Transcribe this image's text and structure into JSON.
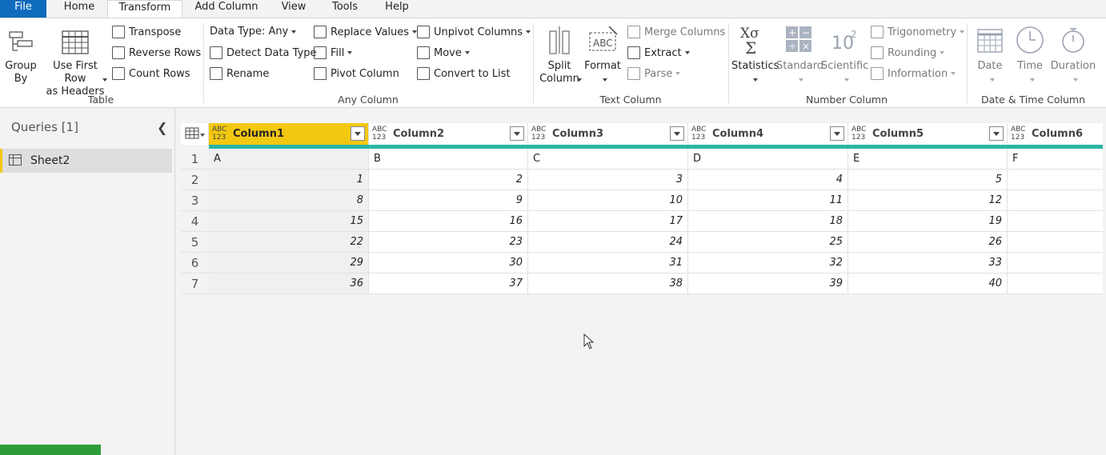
{
  "menu": {
    "tabs": [
      {
        "label": "File"
      },
      {
        "label": "Home"
      },
      {
        "label": "Transform"
      },
      {
        "label": "Add Column"
      },
      {
        "label": "View"
      },
      {
        "label": "Tools"
      },
      {
        "label": "Help"
      }
    ]
  },
  "ribbon": {
    "table": {
      "label": "Table",
      "group_by": "Group\nBy",
      "use_first_row": "Use First Row\nas Headers",
      "transpose": "Transpose",
      "reverse_rows": "Reverse Rows",
      "count_rows": "Count Rows"
    },
    "any_column": {
      "label": "Any Column",
      "data_type": "Data Type: Any",
      "detect_data_type": "Detect Data Type",
      "rename": "Rename",
      "replace_values": "Replace Values",
      "fill": "Fill",
      "pivot_column": "Pivot Column",
      "unpivot_columns": "Unpivot Columns",
      "move": "Move",
      "convert_to_list": "Convert to List"
    },
    "text_column": {
      "label": "Text Column",
      "split_column": "Split\nColumn",
      "format": "Format",
      "merge_columns": "Merge Columns",
      "extract": "Extract",
      "parse": "Parse"
    },
    "number_column": {
      "label": "Number Column",
      "statistics": "Statistics",
      "standard": "Standard",
      "scientific": "Scientific",
      "trigonometry": "Trigonometry",
      "rounding": "Rounding",
      "information": "Information"
    },
    "datetime_column": {
      "label": "Date & Time Column",
      "date": "Date",
      "time": "Time",
      "duration": "Duration"
    }
  },
  "queries": {
    "title": "Queries [1]",
    "items": [
      {
        "label": "Sheet2"
      }
    ]
  },
  "grid": {
    "columns": [
      {
        "type": "ABC\n123",
        "name": "Column1"
      },
      {
        "type": "ABC\n123",
        "name": "Column2"
      },
      {
        "type": "ABC\n123",
        "name": "Column3"
      },
      {
        "type": "ABC\n123",
        "name": "Column4"
      },
      {
        "type": "ABC\n123",
        "name": "Column5"
      },
      {
        "type": "ABC\n123",
        "name": "Column6"
      }
    ],
    "row_numbers": [
      "1",
      "2",
      "3",
      "4",
      "5",
      "6",
      "7"
    ],
    "rows": [
      [
        "A",
        "B",
        "C",
        "D",
        "E",
        "F"
      ],
      [
        "1",
        "2",
        "3",
        "4",
        "5",
        ""
      ],
      [
        "8",
        "9",
        "10",
        "11",
        "12",
        ""
      ],
      [
        "15",
        "16",
        "17",
        "18",
        "19",
        ""
      ],
      [
        "22",
        "23",
        "24",
        "25",
        "26",
        ""
      ],
      [
        "29",
        "30",
        "31",
        "32",
        "33",
        ""
      ],
      [
        "36",
        "37",
        "38",
        "39",
        "40",
        ""
      ]
    ]
  },
  "colors": {
    "file_tab": "#0f6cbd",
    "selected_column": "#f2c811",
    "quality_bar": "#2bb5a5",
    "progress": "#2f9c3a"
  }
}
